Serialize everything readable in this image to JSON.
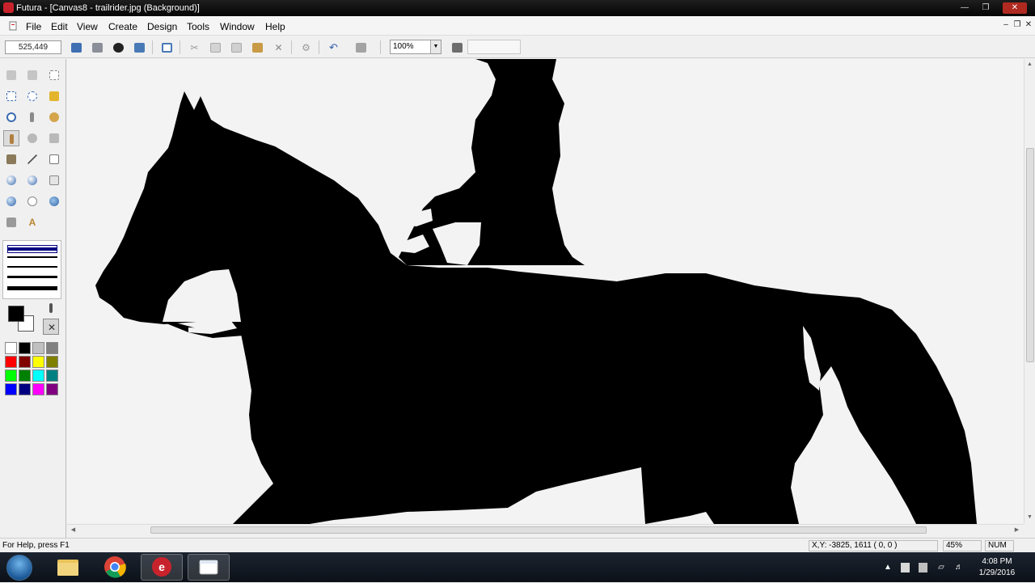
{
  "window": {
    "title": "Futura - [Canvas8 - trailrider.jpg (Background)]",
    "controls": [
      "minimize",
      "maximize",
      "close"
    ]
  },
  "menu": {
    "items": [
      "File",
      "Edit",
      "View",
      "Create",
      "Design",
      "Tools",
      "Window",
      "Help"
    ]
  },
  "toolbar": {
    "coordinates": "525,449",
    "zoom": "100%",
    "buttons": [
      "save-icon",
      "print-icon",
      "info-icon",
      "import-icon",
      "frame-icon",
      "cut-icon",
      "copy-icon",
      "copy-merged-icon",
      "paste-icon",
      "delete-icon",
      "settings-icon",
      "undo-icon",
      "redo-icon",
      "grid-icon"
    ]
  },
  "toolbox": {
    "tools": [
      "lasso-icon",
      "magic-select-icon",
      "marquee-icon",
      "rectangle-select-icon",
      "ellipse-select-icon",
      "magic-wand-icon",
      "zoom-icon",
      "eyedropper-icon",
      "smudge-icon",
      "pencil-icon",
      "clone-icon",
      "transform-icon",
      "paint-bucket-icon",
      "line-icon",
      "rectangle-icon",
      "sphere-icon",
      "orb-icon",
      "square-shape-icon",
      "circle-icon",
      "ring-icon",
      "globe-icon",
      "cross-icon",
      "text-icon"
    ],
    "line_widths": [
      4,
      2,
      2,
      3,
      5
    ],
    "foreground_color": "#000000",
    "background_color": "#ffffff",
    "palette": [
      "#ffffff",
      "#000000",
      "#c0c0c0",
      "#808080",
      "#ff0000",
      "#800000",
      "#ffff00",
      "#808000",
      "#00ff00",
      "#008000",
      "#00ffff",
      "#008080",
      "#0000ff",
      "#000080",
      "#ff00ff",
      "#800080"
    ]
  },
  "canvas": {
    "image_file": "trailrider.jpg",
    "subject": "horse and rider silhouette",
    "silhouette_color": "#000000",
    "background_color": "#f3f3f3"
  },
  "statusbar": {
    "help_text": "For Help, press F1",
    "position": "X,Y: -3825, 1611  ( 0, 0 )",
    "zoom": "45%",
    "num_lock": "NUM"
  },
  "taskbar": {
    "apps": [
      "explorer",
      "chrome",
      "futura",
      "folder"
    ],
    "active_app": "futura",
    "time": "4:08 PM",
    "date": "1/29/2016"
  },
  "colors": {
    "accent": "#000080",
    "titlebar": "#0b0b0b"
  }
}
